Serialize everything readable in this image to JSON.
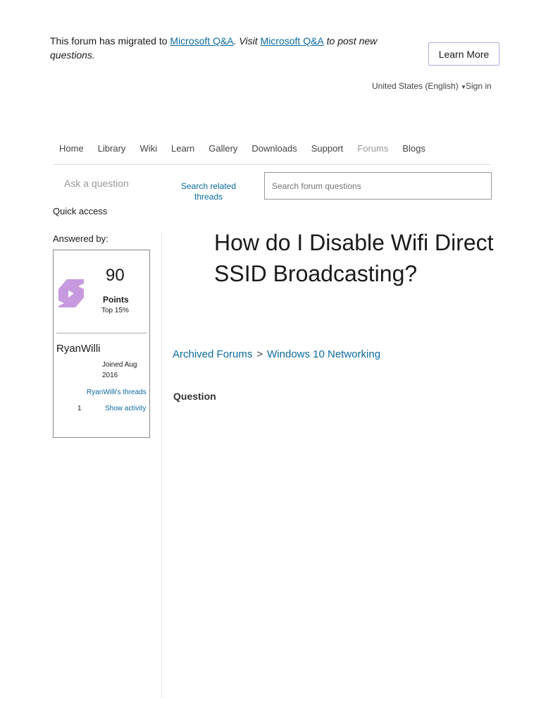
{
  "banner": {
    "text1": "This forum has migrated to ",
    "link1": "Microsoft Q&A",
    "text2": ". Visit ",
    "link2": "Microsoft Q&A",
    "text3": " to post new questions.",
    "learn_more": "Learn More"
  },
  "util": {
    "locale": "United States (English)",
    "sign_in": "Sign in"
  },
  "nav": [
    "Home",
    "Library",
    "Wiki",
    "Learn",
    "Gallery",
    "Downloads",
    "Support",
    "Forums",
    "Blogs"
  ],
  "ask": "Ask a question",
  "related": "Search related threads",
  "search_placeholder": "Search forum questions",
  "quick_access": "Quick access",
  "answered_by": "Answered by:",
  "user": {
    "points": "90",
    "points_label": "Points",
    "rank": "Top 15%",
    "name": "RyanWilli",
    "joined": "Joined Aug 2016",
    "threads": "RyanWilli's threads",
    "count": "1",
    "activity": "Show activity"
  },
  "title": "How do I Disable Wifi Direct SSID Broadcasting?",
  "breadcrumb": [
    "Archived Forums",
    "Windows 10 Networking"
  ],
  "question_label": "Question"
}
